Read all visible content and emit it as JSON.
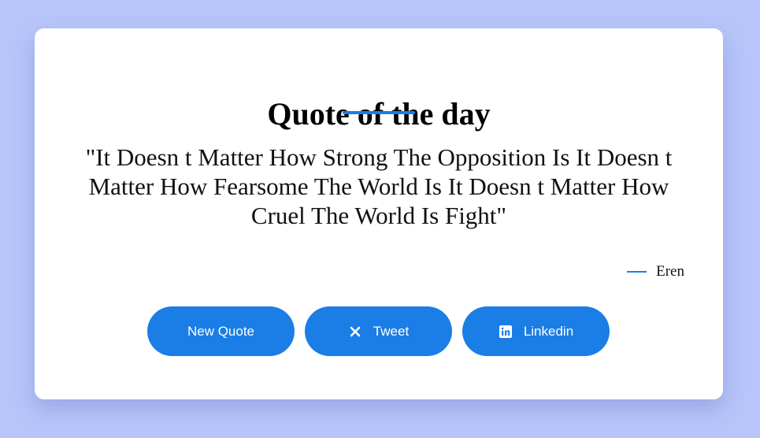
{
  "card": {
    "title": "Quote of the day",
    "quote": "\"It Doesn t Matter How Strong The Opposition Is It Doesn t Matter How Fearsome The World Is It Doesn t Matter How Cruel The World Is Fight\"",
    "author": "Eren"
  },
  "buttons": {
    "new_quote_label": "New Quote",
    "tweet_label": "Tweet",
    "tweet_icon": "x-icon",
    "linkedin_label": "Linkedin",
    "linkedin_icon": "linkedin-icon"
  },
  "colors": {
    "background": "#b8c5fa",
    "accent": "#1b7de6",
    "card": "#ffffff"
  }
}
